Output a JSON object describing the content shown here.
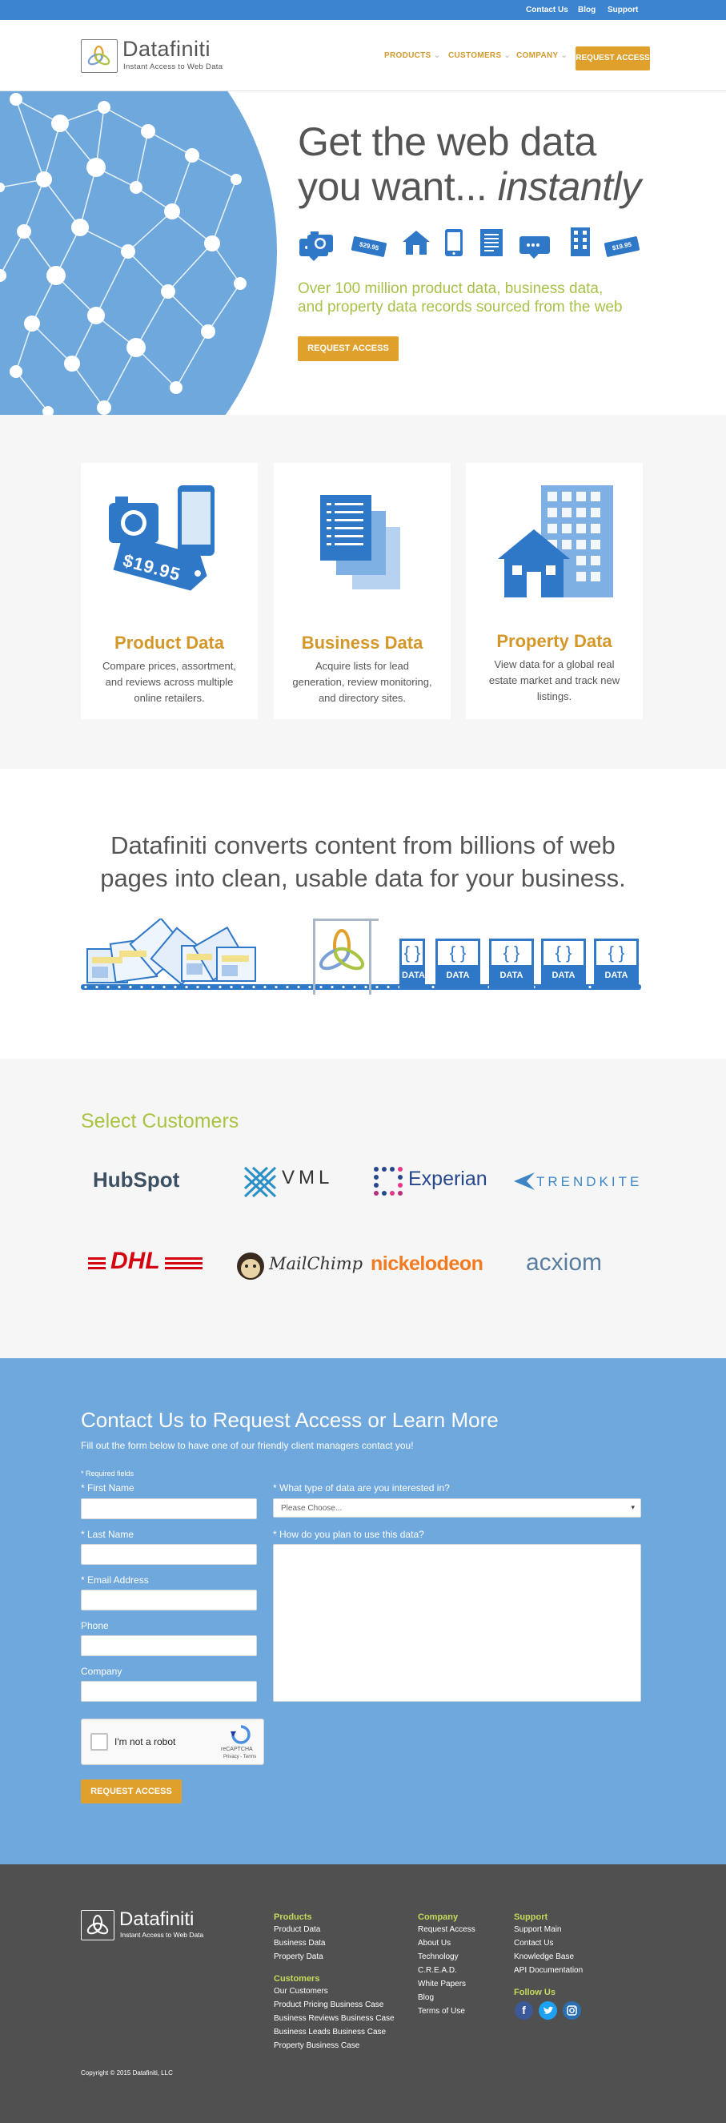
{
  "topbar": {
    "links": [
      "Contact Us",
      "Blog",
      "Support"
    ]
  },
  "brand": {
    "name": "Datafiniti",
    "tagline": "Instant Access to Web Data"
  },
  "nav": {
    "items": [
      "PRODUCTS",
      "CUSTOMERS",
      "COMPANY"
    ],
    "cta": "REQUEST ACCESS"
  },
  "hero": {
    "line1": "Get the web data",
    "line2a": "you want... ",
    "line2b": "instantly",
    "sub1": "Over 100 million product data, business data,",
    "sub2": "and property data records sourced from the web",
    "cta": "REQUEST ACCESS",
    "price_tags": [
      "$29.95",
      "$19.95"
    ]
  },
  "products": [
    {
      "title": "Product Data",
      "desc": "Compare prices, assortment, and reviews across multiple online retailers.",
      "price": "$19.95"
    },
    {
      "title": "Business Data",
      "desc": "Acquire lists for lead generation, review monitoring, and directory sites."
    },
    {
      "title": "Property Data",
      "desc": "View data for a global real estate market and track new listings."
    }
  ],
  "converts": {
    "line1": "Datafiniti converts content from billions of web",
    "line2": "pages into clean, usable data for your business.",
    "data_label": "DATA",
    "bracket_glyph": "{ }"
  },
  "customers": {
    "title": "Select Customers",
    "logos": [
      "HubSpot",
      "VML",
      "Experian",
      "TRENDKITE",
      "DHL",
      "MailChimp",
      "nickelodeon",
      "acxiom"
    ]
  },
  "contact": {
    "title": "Contact Us to Request Access or Learn More",
    "subtitle": "Fill out the form below to have one of our friendly client managers contact you!",
    "required_note": "* Required fields",
    "fields": [
      "* First Name",
      "* Last Name",
      "* Email Address",
      "Phone",
      "Company"
    ],
    "type_label": "* What type of data are you interested in?",
    "type_placeholder": "Please Choose...",
    "use_label": "* How do you plan to use this data?",
    "captcha_label": "I'm not a robot",
    "captcha_brand": "reCAPTCHA",
    "captcha_links": "Privacy - Terms",
    "submit": "REQUEST ACCESS"
  },
  "footer": {
    "products": {
      "title": "Products",
      "items": [
        "Product Data",
        "Business Data",
        "Property Data"
      ]
    },
    "customers": {
      "title": "Customers",
      "items": [
        "Our Customers",
        "Product Pricing Business Case",
        "Business Reviews Business Case",
        "Business Leads Business Case",
        "Property Business Case"
      ]
    },
    "company": {
      "title": "Company",
      "items": [
        "Request Access",
        "About Us",
        "Technology",
        "C.R.E.A.D.",
        "White Papers",
        "Blog",
        "Terms of Use"
      ]
    },
    "support": {
      "title": "Support",
      "items": [
        "Support Main",
        "Contact Us",
        "Knowledge Base",
        "API Documentation"
      ]
    },
    "follow": "Follow Us",
    "copyright": "Copyright © 2015 Datafiniti, LLC"
  },
  "colors": {
    "blue": "#3c84cf",
    "gold": "#dfa02c",
    "green": "#a9c443",
    "contact_bg": "#6fa8dc",
    "footer_bg": "#505050"
  }
}
